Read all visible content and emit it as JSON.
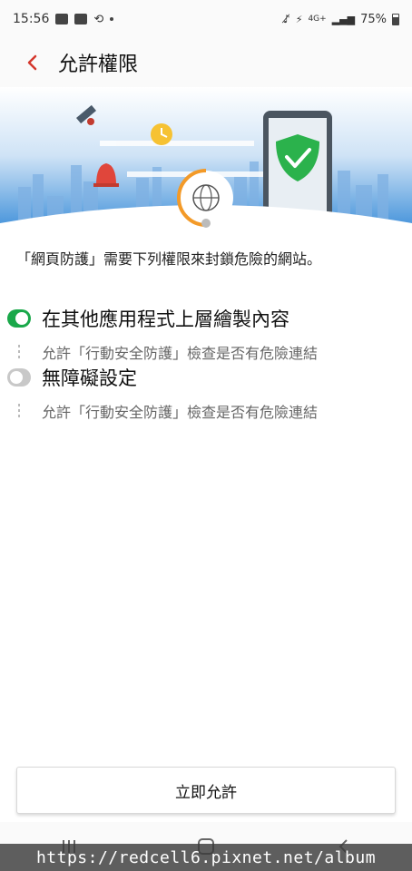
{
  "status_bar": {
    "time": "15:56",
    "battery": "75%",
    "network": "4G+",
    "left_icons": [
      "mail-icon",
      "gallery-icon",
      "sync-icon",
      "dot-icon"
    ],
    "right_icons": [
      "mute-icon",
      "wifi-icon",
      "signal-icon",
      "battery-icon"
    ]
  },
  "app_bar": {
    "title": "允許權限",
    "back_icon": "chevron-left-icon",
    "accent_color": "#d4372c"
  },
  "hero": {
    "icons": [
      "satellite-icon",
      "clock-icon",
      "bell-icon",
      "globe-icon",
      "shield-check-icon",
      "phone-icon"
    ],
    "shield_color": "#2bb24c",
    "sky_color": "#3a8fd8"
  },
  "description": "「網頁防護」需要下列權限來封鎖危險的網站。",
  "permissions": [
    {
      "title": "在其他應用程式上層繪製內容",
      "desc": "允許「行動安全防護」檢查是否有危險連結",
      "state": "on"
    },
    {
      "title": "無障礙設定",
      "desc": "允許「行動安全防護」檢查是否有危險連結",
      "state": "off"
    }
  ],
  "allow_button": "立即允許",
  "nav_bar": {
    "icons": [
      "recent-apps-icon",
      "home-icon",
      "back-icon"
    ]
  },
  "watermark": "https://redcell6.pixnet.net/album"
}
